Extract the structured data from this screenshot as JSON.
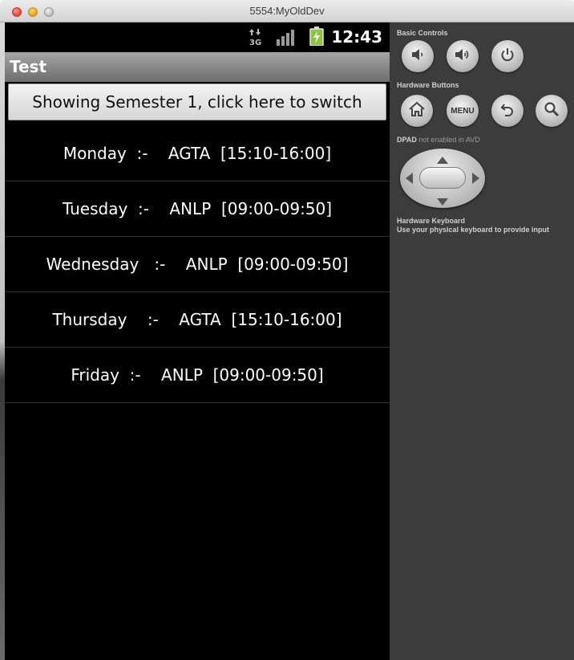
{
  "window": {
    "title": "5554:MyOldDev"
  },
  "statusbar": {
    "network_icon": "3g-data-icon",
    "network_label": "3G",
    "signal_icon": "signal-bars-icon",
    "battery_icon": "battery-charging-icon",
    "time": "12:43"
  },
  "app": {
    "title": "Test",
    "switch_button_label": "Showing Semester 1, click here to switch"
  },
  "schedule": [
    {
      "day": "Monday",
      "text": "Monday  :-    AGTA  [15:10-16:00]"
    },
    {
      "day": "Tuesday",
      "text": "Tuesday  :-    ANLP  [09:00-09:50]"
    },
    {
      "day": "Wednesday",
      "text": "Wednesday   :-    ANLP  [09:00-09:50]"
    },
    {
      "day": "Thursday",
      "text": "Thursday    :-    AGTA  [15:10-16:00]"
    },
    {
      "day": "Friday",
      "text": "Friday  :-    ANLP  [09:00-09:50]"
    }
  ],
  "controls": {
    "basic_controls_label": "Basic Controls",
    "hardware_buttons_label": "Hardware Buttons",
    "menu_label": "MENU",
    "dpad_label": "DPAD",
    "dpad_note": "not enabled in AVD",
    "keyboard_label": "Hardware Keyboard",
    "keyboard_note": "Use your physical keyboard to provide input"
  },
  "colors": {
    "screen_background": "#000000",
    "panel_background": "#3c3c3c",
    "battery_green": "#8cc63f"
  }
}
